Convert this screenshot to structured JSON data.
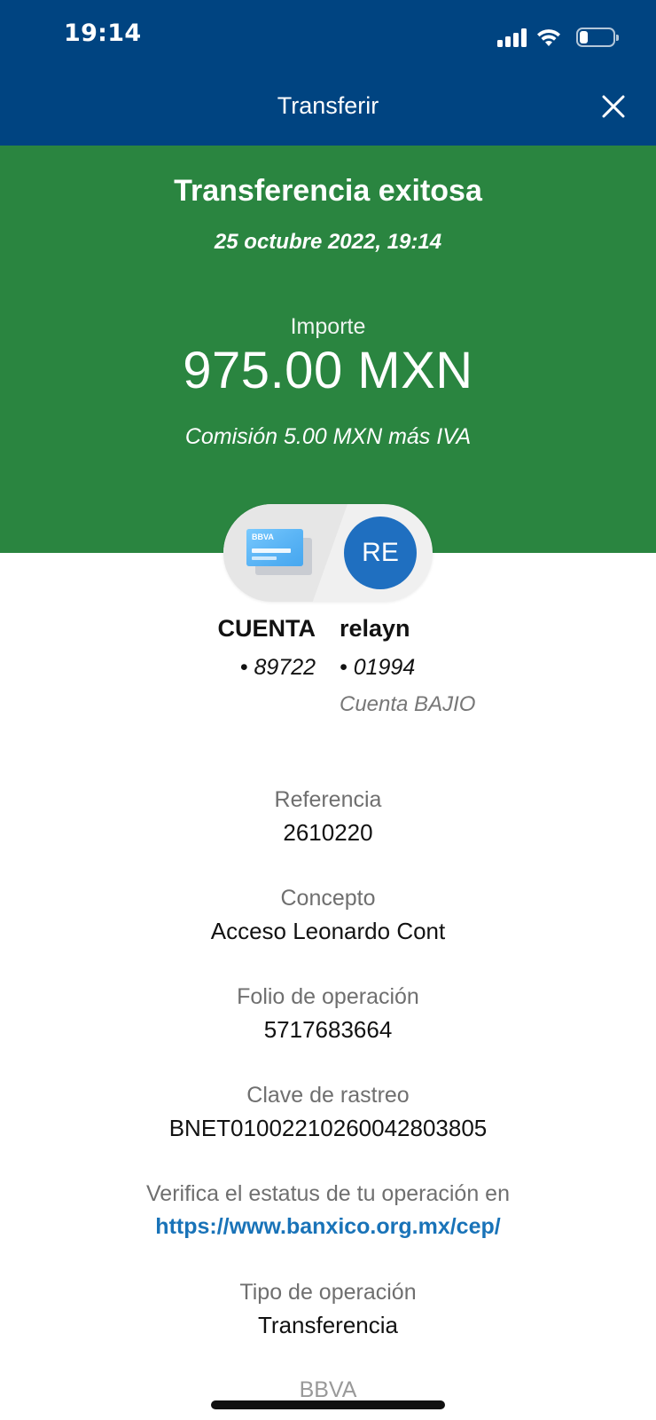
{
  "status_bar": {
    "time": "19:14",
    "battery_level": 0.25,
    "icons": [
      "signal-icon",
      "wifi-icon",
      "battery-icon"
    ]
  },
  "nav": {
    "title": "Transferir",
    "close_icon": "close-icon"
  },
  "banner": {
    "title": "Transferencia exitosa",
    "date": "25 octubre 2022, 19:14",
    "amount_label": "Importe",
    "amount_value": "975.00 MXN",
    "commission": "Comisión 5.00 MXN más IVA"
  },
  "origin_account": {
    "name": "CUENTA",
    "number": "• 89722",
    "card_brand": "BBVA"
  },
  "destination_account": {
    "initials": "RE",
    "name": "relayn",
    "number": "• 01994",
    "bank": "Cuenta BAJIO"
  },
  "details": [
    {
      "label": "Referencia",
      "value": "2610220"
    },
    {
      "label": "Concepto",
      "value": "Acceso Leonardo Cont"
    },
    {
      "label": "Folio de operación",
      "value": "5717683664"
    },
    {
      "label": "Clave de rastreo",
      "value": "BNET01002210260042803805"
    },
    {
      "label": "Verifica el estatus de tu operación en",
      "link": "https://www.banxico.org.mx/cep/"
    },
    {
      "label": "Tipo de operación",
      "value": "Transferencia"
    }
  ],
  "footer_faded": "BBVA",
  "colors": {
    "header_blue": "#004481",
    "success_green": "#2a8540",
    "link_blue": "#1973b8",
    "avatar_blue": "#1f6fc0"
  }
}
